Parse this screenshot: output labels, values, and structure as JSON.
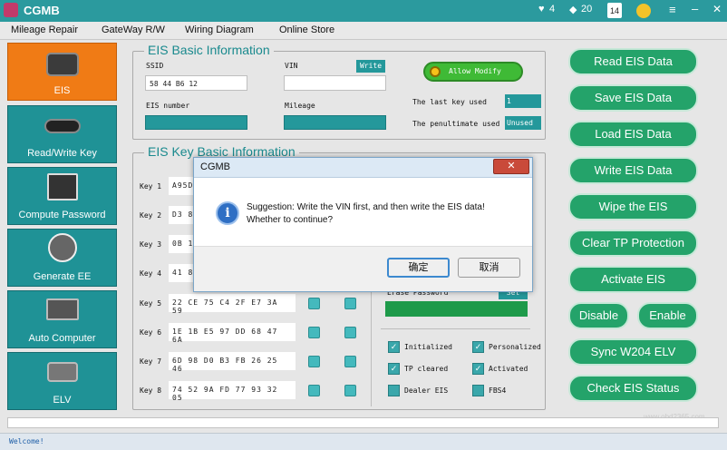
{
  "app": {
    "title": "CGMB"
  },
  "titlebar": {
    "hearts": "4",
    "gems": "20",
    "calendar_day": "14"
  },
  "menu": [
    {
      "label": "Mileage Repair"
    },
    {
      "label": "GateWay R/W"
    },
    {
      "label": "Wiring Diagram"
    },
    {
      "label": "Online Store"
    }
  ],
  "nav": [
    {
      "label": "EIS",
      "icon": "eis-icon"
    },
    {
      "label": "Read/Write Key",
      "icon": "car-key-icon"
    },
    {
      "label": "Compute Password",
      "icon": "keypad-icon"
    },
    {
      "label": "Generate EE",
      "icon": "chip-icon"
    },
    {
      "label": "Auto Computer",
      "icon": "ecu-icon"
    },
    {
      "label": "ELV",
      "icon": "elv-icon"
    }
  ],
  "eis_basic": {
    "title": "EIS Basic Information",
    "ssid_label": "SSID",
    "ssid_value": "58 44 B6 12",
    "vin_label": "VIN",
    "vin_value": "",
    "write_label": "Write",
    "allow_modify_label": "Allow Modify",
    "eis_number_label": "EIS number",
    "mileage_label": "Mileage",
    "last_key_label": "The last key used",
    "last_key_value": "1",
    "penultimate_label": "The penultimate used",
    "penultimate_value": "Unused"
  },
  "eis_key": {
    "title": "EIS Key Basic Information",
    "keys": [
      {
        "label": "Key 1",
        "value": "A95D5"
      },
      {
        "label": "Key 2",
        "value": "D3 8"
      },
      {
        "label": "Key 3",
        "value": "0B 1"
      },
      {
        "label": "Key 4",
        "value": "41 8"
      },
      {
        "label": "Key 5",
        "value": "22 CE 75 C4 2F E7 3A 59"
      },
      {
        "label": "Key 6",
        "value": "1E 1B E5 97 DD 68 47 6A"
      },
      {
        "label": "Key 7",
        "value": "6D 98 D0 B3 FB 26 25 46"
      },
      {
        "label": "Key 8",
        "value": "74 52 9A FD 77 93 32 05"
      }
    ],
    "erase_password_label": "Erase Password",
    "set_label": "Set",
    "checks": [
      {
        "label": "Initialized",
        "checked": true
      },
      {
        "label": "Personalized",
        "checked": true
      },
      {
        "label": "TP cleared",
        "checked": true
      },
      {
        "label": "Activated",
        "checked": true
      },
      {
        "label": "Dealer EIS",
        "checked": false
      },
      {
        "label": "FBS4",
        "checked": false
      }
    ]
  },
  "right_buttons": [
    {
      "label": "Read  EIS Data"
    },
    {
      "label": "Save EIS Data"
    },
    {
      "label": "Load EIS Data"
    },
    {
      "label": "Write EIS Data"
    },
    {
      "label": "Wipe the EIS"
    },
    {
      "label": "Clear TP Protection"
    },
    {
      "label": "Activate EIS"
    },
    {
      "label": "Disable"
    },
    {
      "label": "Enable"
    },
    {
      "label": "Sync W204 ELV"
    },
    {
      "label": "Check EIS Status"
    }
  ],
  "dialog": {
    "title": "CGMB",
    "message_line1": "Suggestion: Write the VIN first, and then write the EIS data!",
    "message_line2": "Whether to continue?",
    "ok_label": "确定",
    "cancel_label": "取消"
  },
  "status": {
    "text": "Welcome!"
  },
  "watermark": {
    "text": "www.obd2365.com"
  },
  "colors": {
    "teal": "#24989b",
    "orange": "#f07b15",
    "green": "#24a36a"
  }
}
